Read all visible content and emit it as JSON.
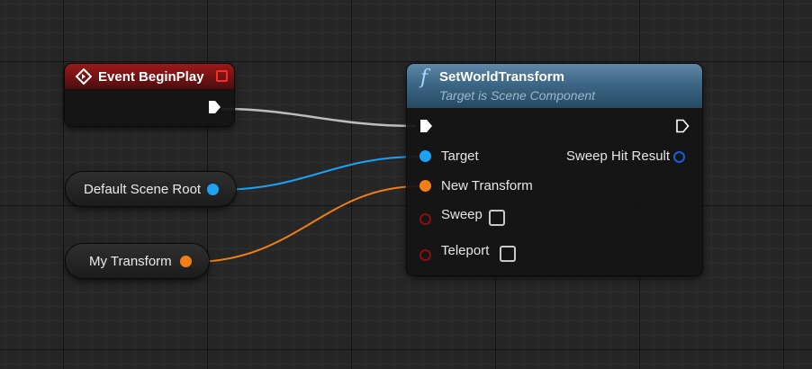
{
  "event_node": {
    "title": "Event BeginPlay",
    "color": "#8f1818"
  },
  "getters": {
    "scene_root": {
      "label": "Default Scene Root",
      "pin_color": "#1da1f2"
    },
    "transform": {
      "label": "My Transform",
      "pin_color": "#f07f1a"
    }
  },
  "function_node": {
    "title": "SetWorldTransform",
    "subtitle": "Target is Scene Component",
    "icon": "function-f-icon",
    "inputs": {
      "target": "Target",
      "new_transform": "New Transform",
      "sweep": "Sweep",
      "teleport": "Teleport"
    },
    "outputs": {
      "sweep_hit_result": "Sweep Hit Result"
    },
    "sweep_checked": false,
    "teleport_checked": false
  },
  "colors": {
    "exec": "#ffffff",
    "object_pin": "#1da1f2",
    "struct_pin": "#f07f1a",
    "bool_pin": "#8b0f0f",
    "hit_result_pin": "#1b5fd8"
  }
}
